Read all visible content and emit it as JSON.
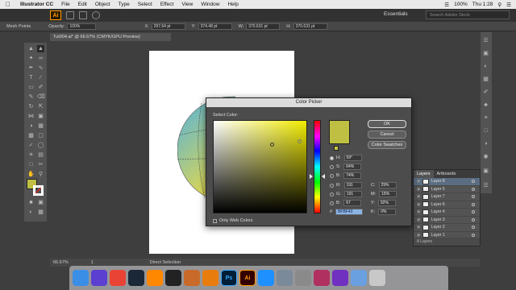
{
  "menubar": {
    "app_name": "Illustrator CC",
    "items": [
      "File",
      "Edit",
      "Object",
      "Type",
      "Select",
      "Effect",
      "View",
      "Window",
      "Help"
    ],
    "battery": "100%",
    "clock": "Thu 1:28"
  },
  "appbar": {
    "logo": "Ai",
    "workspace": "Essentials",
    "search_placeholder": "Search Adobe Stock"
  },
  "controlbar": {
    "selection_label": "Mesh Points",
    "opacity_label": "Opacity:",
    "opacity_value": "100%",
    "x_label": "X:",
    "x_value": "297.64 pt",
    "y_label": "Y:",
    "y_value": "374.48 pt",
    "w_label": "W:",
    "w_value": "370.631 pt",
    "h_label": "H:",
    "h_value": "370.631 pt"
  },
  "document": {
    "tab_title": "Tut004.ai* @ 66.67% (CMYK/GPU Preview)"
  },
  "color_picker": {
    "title": "Color Picker",
    "select_label": "Select Color:",
    "ok": "OK",
    "cancel": "Cancel",
    "swatches": "Color Swatches",
    "hsb": [
      {
        "label": "H:",
        "value": "59°",
        "unit": "",
        "selected": true
      },
      {
        "label": "S:",
        "value": "64%",
        "unit": "",
        "selected": false
      },
      {
        "label": "B:",
        "value": "74%",
        "unit": "",
        "selected": false
      }
    ],
    "rgb": [
      {
        "label": "R:",
        "value": "191"
      },
      {
        "label": "G:",
        "value": "191"
      },
      {
        "label": "B:",
        "value": "67"
      }
    ],
    "cmyk": [
      {
        "label": "C:",
        "value": "29%"
      },
      {
        "label": "M:",
        "value": "15%"
      },
      {
        "label": "Y:",
        "value": "92%"
      },
      {
        "label": "K:",
        "value": "0%"
      }
    ],
    "hex_label": "#",
    "hex_value": "BFBF43",
    "web_colors_label": "Only Web Colors",
    "current_color": "#bfbf43"
  },
  "layers_panel": {
    "tabs": [
      "Layers",
      "Artboards"
    ],
    "layers": [
      "Layer 8",
      "Layer 5",
      "Layer 7",
      "Layer 6",
      "Layer 4",
      "Layer 3",
      "Layer 2",
      "Layer 1"
    ],
    "selected_layer": "Layer 8",
    "footer": "8 Layers"
  },
  "statusbar": {
    "zoom": "66.67%",
    "artboard": "1",
    "tool": "Direct Selection"
  },
  "dock": {
    "apps": [
      {
        "name": "finder-app",
        "label": "",
        "color": "#3a8ee6"
      },
      {
        "name": "siri-app",
        "label": "",
        "color": "#5a3fd0"
      },
      {
        "name": "chrome-app",
        "label": "",
        "color": "#e94335"
      },
      {
        "name": "steam-app",
        "label": "",
        "color": "#1b2838"
      },
      {
        "name": "vlc-app",
        "label": "",
        "color": "#ff8800"
      },
      {
        "name": "unity-app",
        "label": "",
        "color": "#222222"
      },
      {
        "name": "cat-app",
        "label": "",
        "color": "#c96a2a"
      },
      {
        "name": "blender-app",
        "label": "",
        "color": "#e87d0d"
      },
      {
        "name": "photoshop-app",
        "label": "Ps",
        "color": "#001e36"
      },
      {
        "name": "illustrator-app",
        "label": "Ai",
        "color": "#330000"
      },
      {
        "name": "appstore-app",
        "label": "",
        "color": "#1e90ff"
      },
      {
        "name": "photo-app",
        "label": "",
        "color": "#7a8a9a"
      },
      {
        "name": "settings-app",
        "label": "",
        "color": "#8a8a8a"
      },
      {
        "name": "gamecenter-app",
        "label": "",
        "color": "#b03060"
      },
      {
        "name": "video-app",
        "label": "",
        "color": "#7030c0"
      },
      {
        "name": "downloads-app",
        "label": "",
        "color": "#6aa0e0"
      },
      {
        "name": "trash-app",
        "label": "",
        "color": "#c8c8c8"
      }
    ]
  }
}
